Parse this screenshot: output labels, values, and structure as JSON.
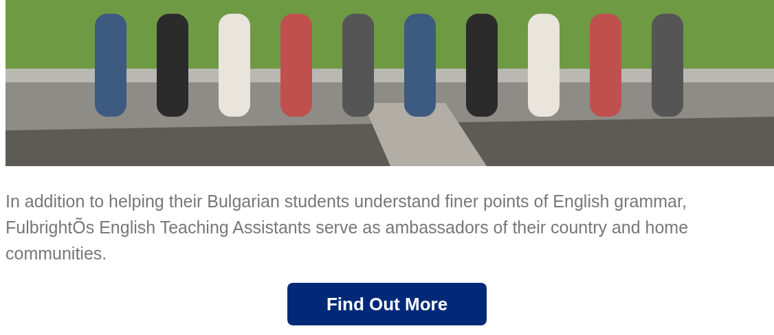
{
  "caption": "In addition to helping their Bulgarian students understand finer points of English grammar, FulbrightÕs English Teaching Assistants serve as ambassadors of their country and home communities.",
  "button": {
    "label": "Find Out More"
  }
}
